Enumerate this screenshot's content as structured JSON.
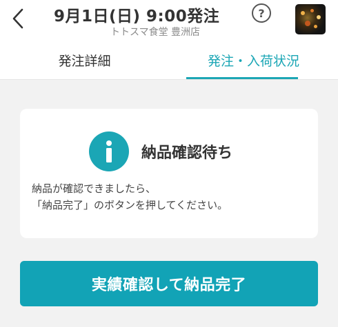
{
  "header": {
    "title": "9月1日(日) 9:00発注",
    "subtitle": "トトスマ食堂 豊洲店",
    "back_icon": "chevron-left-icon",
    "help_icon": "question-circle-icon",
    "help_glyph": "?",
    "avatar": "store-photo"
  },
  "tabs": [
    {
      "label": "発注詳細",
      "active": false
    },
    {
      "label": "発注・入荷状況",
      "active": true
    }
  ],
  "status_card": {
    "icon": "info-icon",
    "icon_glyph": "i",
    "title": "納品確認待ち",
    "message_line1": "納品が確認できましたら、",
    "message_line2": "「納品完了」のボタンを押してください。"
  },
  "action": {
    "complete_label": "実績確認して納品完了"
  },
  "colors": {
    "accent": "#1ba6b5",
    "button": "#12a3b6",
    "background": "#f2f2f2"
  }
}
